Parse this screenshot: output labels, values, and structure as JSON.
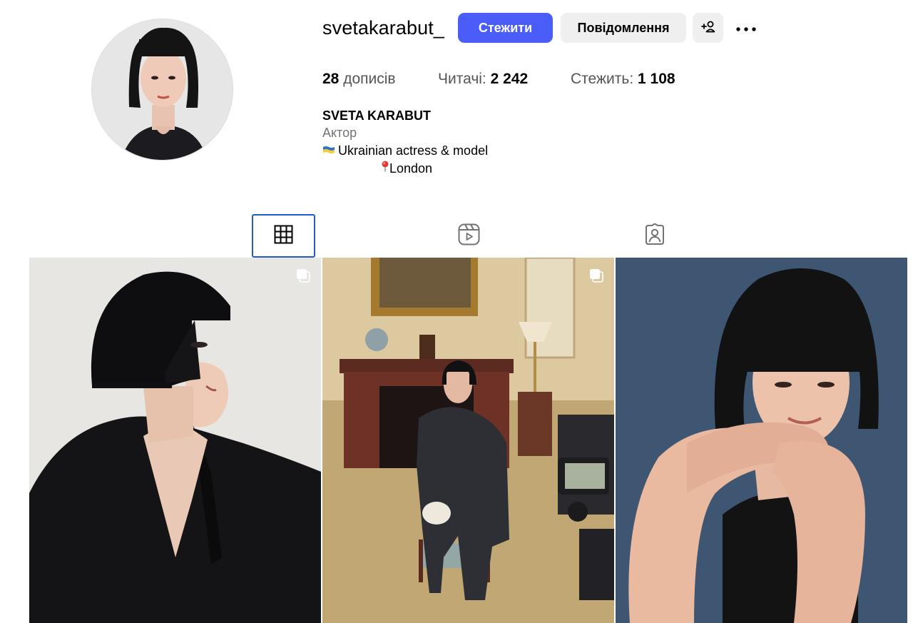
{
  "profile": {
    "username": "svetakarabut_",
    "follow_label": "Стежити",
    "message_label": "Повідомлення",
    "suggest_icon": "person-add-icon",
    "more_icon": "more-options-icon"
  },
  "stats": {
    "posts_count": "28",
    "posts_label": "дописів",
    "followers_label": "Читачі:",
    "followers_count": "2 242",
    "following_label": "Стежить:",
    "following_count": "1 108"
  },
  "bio": {
    "name": "SVETA KARABUT",
    "category": "Актор",
    "line1": "Ukrainian actress & model",
    "line2": "London",
    "flag": "ukraine-flag-icon",
    "pin": "location-pin-icon"
  },
  "tabs": [
    {
      "name": "posts",
      "icon": "grid-icon",
      "active": true
    },
    {
      "name": "reels",
      "icon": "reels-icon",
      "active": false
    },
    {
      "name": "tagged",
      "icon": "tagged-icon",
      "active": false
    }
  ],
  "posts": [
    {
      "type": "carousel"
    },
    {
      "type": "carousel"
    },
    {
      "type": "single"
    }
  ],
  "colors": {
    "accent": "#4a5df9",
    "secondary_button": "#efefef",
    "active_tab_border": "#1f5cc8"
  }
}
